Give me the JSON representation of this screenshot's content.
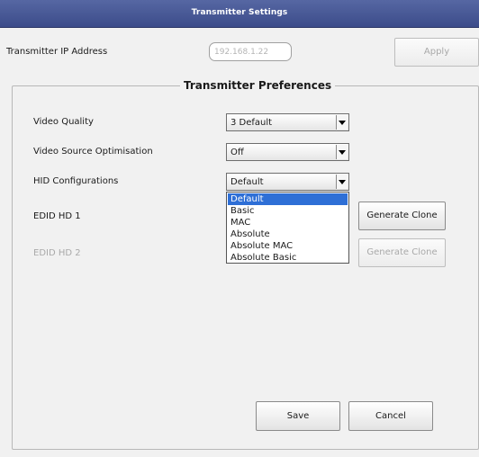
{
  "window": {
    "title": "Transmitter Settings"
  },
  "ip": {
    "label": "Transmitter IP Address",
    "placeholder": "192.168.1.22",
    "apply_label": "Apply"
  },
  "preferences": {
    "legend": "Transmitter Preferences",
    "video_quality": {
      "label": "Video Quality",
      "value": "3 Default"
    },
    "video_source": {
      "label": "Video Source Optimisation",
      "value": "Off"
    },
    "hid": {
      "label": "HID Configurations",
      "value": "Default",
      "options": [
        "Default",
        "Basic",
        "MAC",
        "Absolute",
        "Absolute MAC",
        "Absolute Basic"
      ],
      "selected_index": 0
    },
    "edid1": {
      "label": "EDID HD 1",
      "button": "Generate Clone"
    },
    "edid2": {
      "label": "EDID HD 2",
      "button": "Generate Clone"
    }
  },
  "actions": {
    "save": "Save",
    "cancel": "Cancel"
  }
}
